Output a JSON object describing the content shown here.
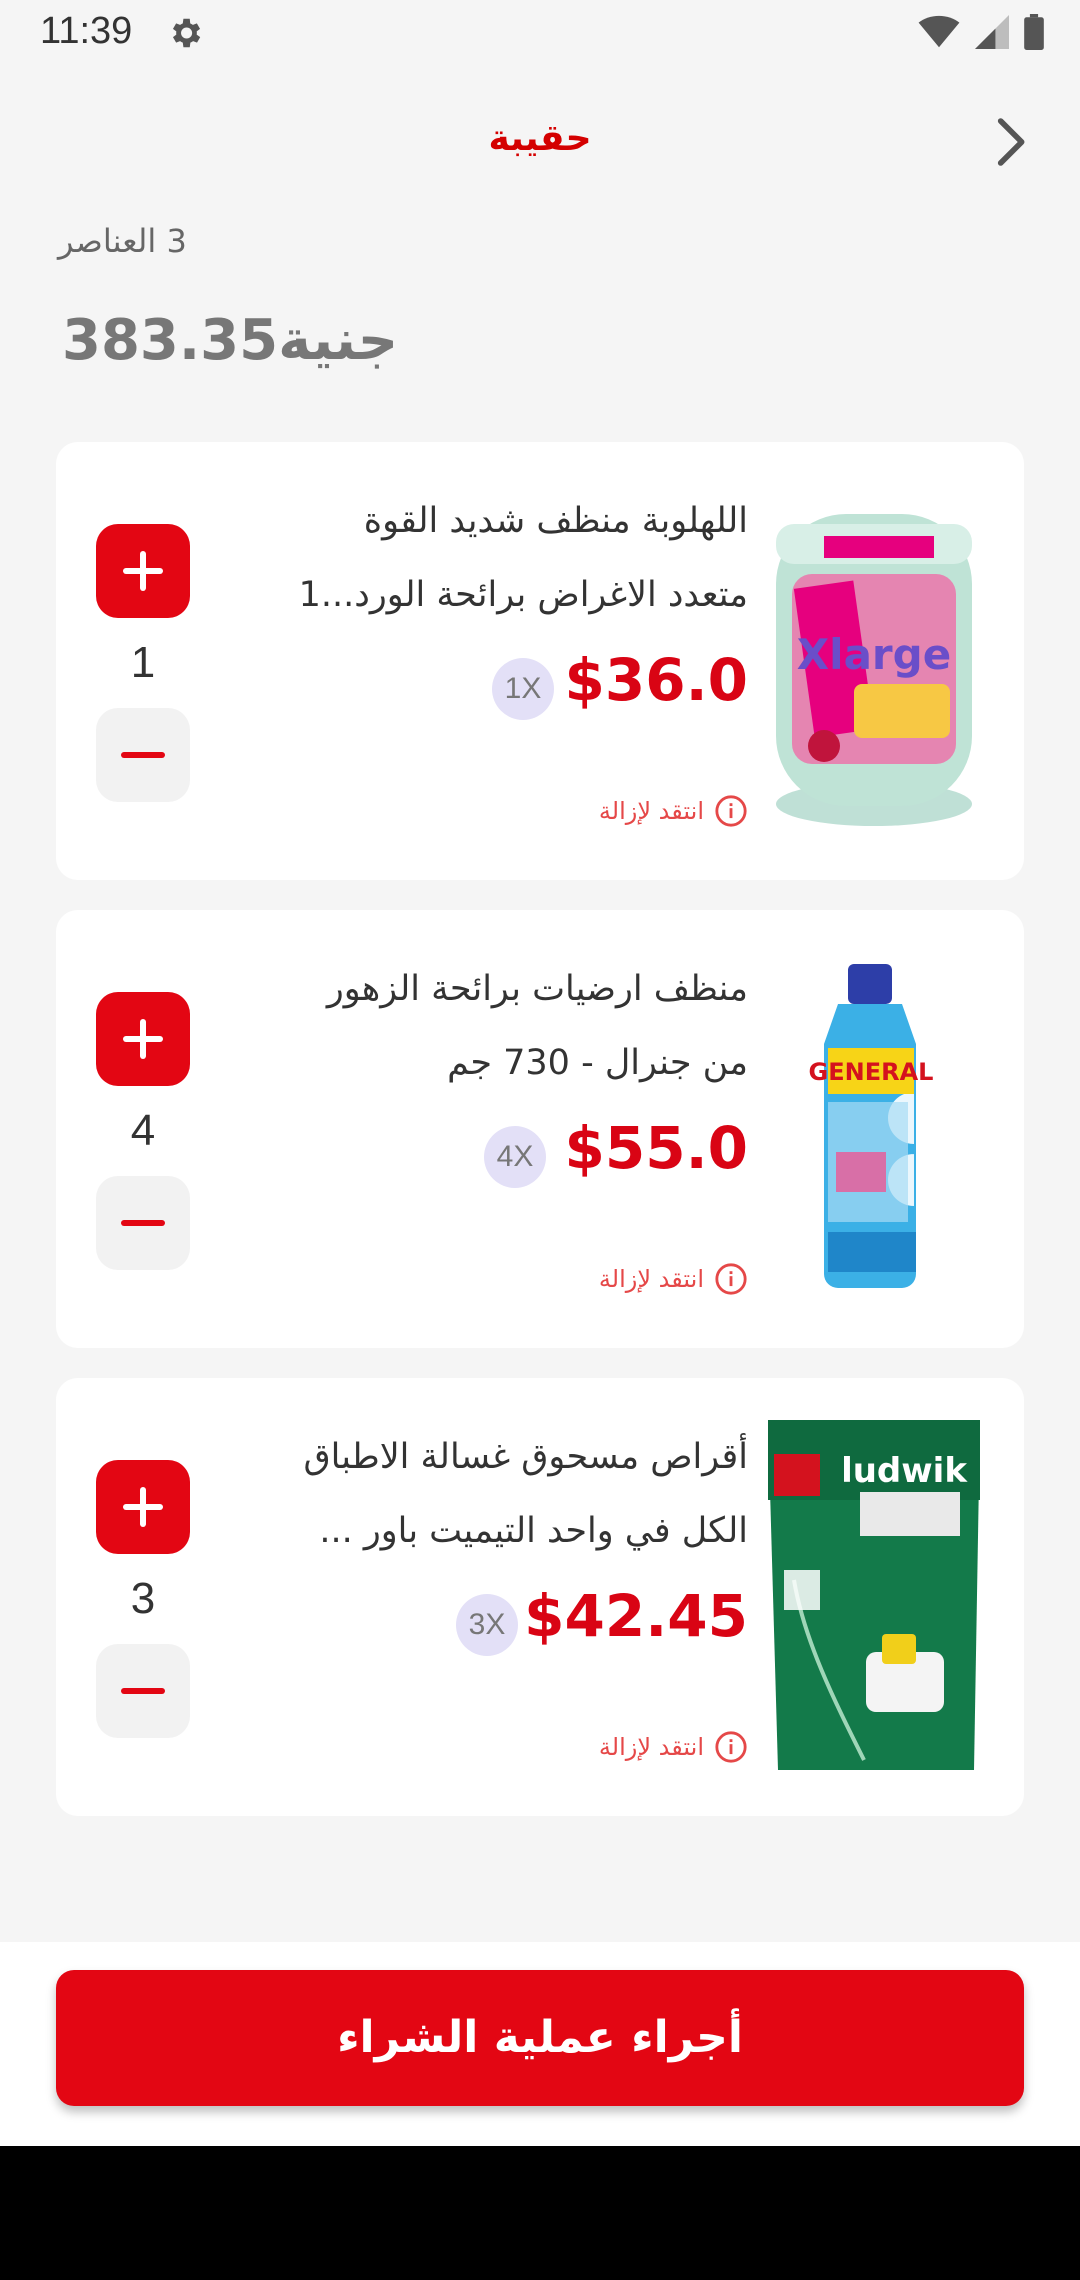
{
  "status_bar": {
    "time": "11:39"
  },
  "header": {
    "title": "حقيبة"
  },
  "summary": {
    "items_count": "3 العناصر",
    "total": "383.35جنية"
  },
  "cart_items": [
    {
      "name_line1": "اللهلوبة منظف شديد القوة",
      "name_line2": "متعدد الاغراض برائحة الورد...1",
      "price": "$36.0",
      "multiplier": "1X",
      "quantity": "1",
      "remove_label": "انتقد لإزالة",
      "image": "xlarge-cleaner-image"
    },
    {
      "name_line1": "منظف ارضيات برائحة الزهور",
      "name_line2": "من جنرال - 730 جم",
      "price": "$55.0",
      "multiplier": "4X",
      "quantity": "4",
      "remove_label": "انتقد لإزالة",
      "image": "general-floor-cleaner-image"
    },
    {
      "name_line1": "أقراص مسحوق غسالة الاطباق",
      "name_line2": "الكل في واحد التيميت باور ...",
      "price": "$42.45",
      "multiplier": "3X",
      "quantity": "3",
      "remove_label": "انتقد لإزالة",
      "image": "ludwik-dishwasher-tablets-image"
    }
  ],
  "checkout": {
    "label": "أجراء عملية الشراء"
  },
  "colors": {
    "accent": "#e30613",
    "price": "#d90414",
    "badge_bg": "#e3e0f7"
  }
}
